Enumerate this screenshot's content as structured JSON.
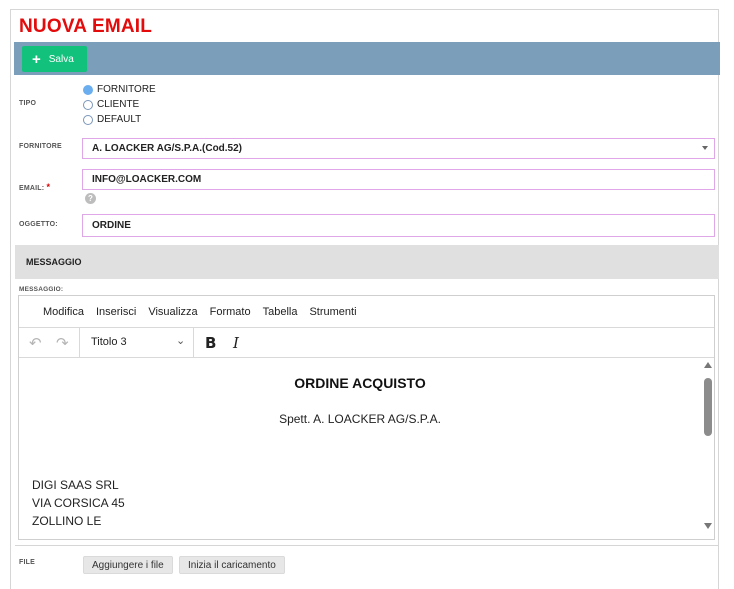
{
  "page_title": "NUOVA EMAIL",
  "toolbar": {
    "save_label": "Salva"
  },
  "tipo": {
    "label": "TIPO",
    "options": [
      "FORNITORE",
      "CLIENTE",
      "DEFAULT"
    ],
    "selected": "FORNITORE"
  },
  "fornitore": {
    "label": "FORNITORE",
    "value": "A. LOACKER AG/S.P.A.(Cod.52)"
  },
  "email": {
    "label": "EMAIL:",
    "required_mark": "*",
    "value": "INFO@LOACKER.COM",
    "help": "?"
  },
  "oggetto": {
    "label": "OGGETTO:",
    "value": "ORDINE"
  },
  "section_title": "MESSAGGIO",
  "messaggio_label": "MESSAGGIO:",
  "editor": {
    "menu": [
      "Modifica",
      "Inserisci",
      "Visualizza",
      "Formato",
      "Tabella",
      "Strumenti"
    ],
    "block_format": "Titolo 3",
    "heading": "ORDINE ACQUISTO",
    "salutation": "Spett. A. LOACKER AG/S.P.A.",
    "lines": [
      "DIGI SAAS SRL",
      "VIA CORSICA 45",
      "ZOLLINO LE"
    ]
  },
  "file": {
    "label": "FILE",
    "add_label": "Aggiungere i file",
    "upload_label": "Inizia il caricamento"
  },
  "colors": {
    "title": "#e30b0b",
    "toolbar_band": "#7b9ebb",
    "save_button": "#12c17c",
    "field_border": "#e0a7e8",
    "radio_selected": "#6aaef0"
  }
}
